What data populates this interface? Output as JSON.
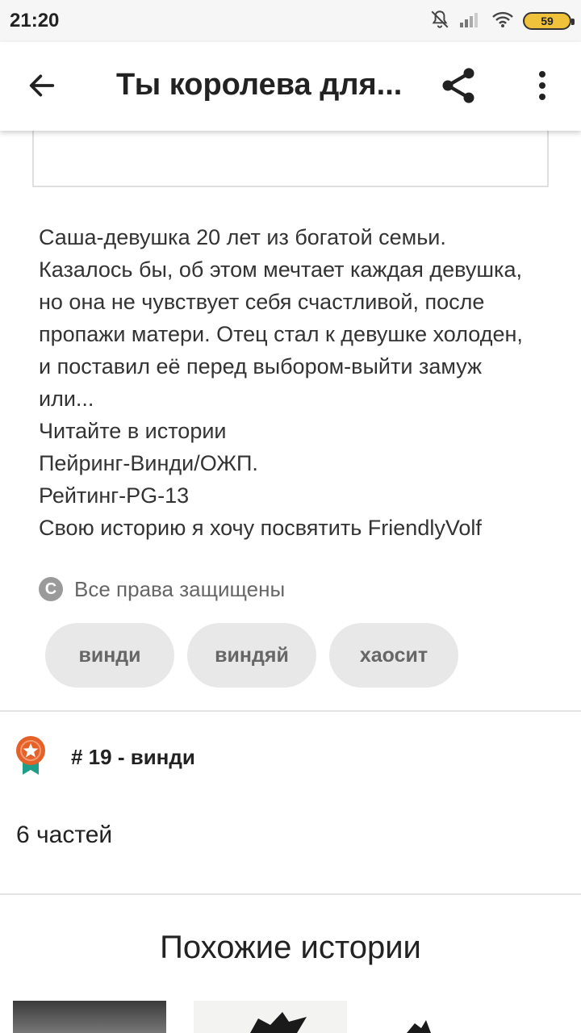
{
  "status_bar": {
    "time": "21:20",
    "battery": "59"
  },
  "app_bar": {
    "title": "Ты королева для..."
  },
  "description": {
    "lines": [
      "Саша-девушка 20 лет из богатой семьи.",
      "Казалось бы, об этом мечтает каждая девушка,",
      "но она не чувствует себя счастливой, после",
      "пропажи матери. Отец стал к девушке холоден,",
      "и поставил её перед выбором-выйти замуж",
      "или...",
      "Читайте в истории",
      "Пейринг-Винди/ОЖП.",
      "Рейтинг-PG-13",
      "Свою историю я хочу посвятить FriendlyVolf"
    ]
  },
  "rights": {
    "icon_letter": "C",
    "label": "Все права защищены"
  },
  "tags": [
    "винди",
    "виндяй",
    "хаосит"
  ],
  "rank": {
    "label": "# 19 - винди"
  },
  "parts": {
    "label": "6 частей"
  },
  "similar": {
    "title": "Похожие истории"
  },
  "colors": {
    "rank_badge": "#e4612a",
    "rank_ribbon": "#1f9e8a",
    "tag_bg": "#e8e8e8"
  },
  "icons": [
    "back-arrow-icon",
    "share-icon",
    "more-vert-icon",
    "copyright-icon",
    "rank-medal-icon",
    "mute-bell-icon",
    "signal-icon",
    "wifi-icon",
    "battery-icon"
  ]
}
